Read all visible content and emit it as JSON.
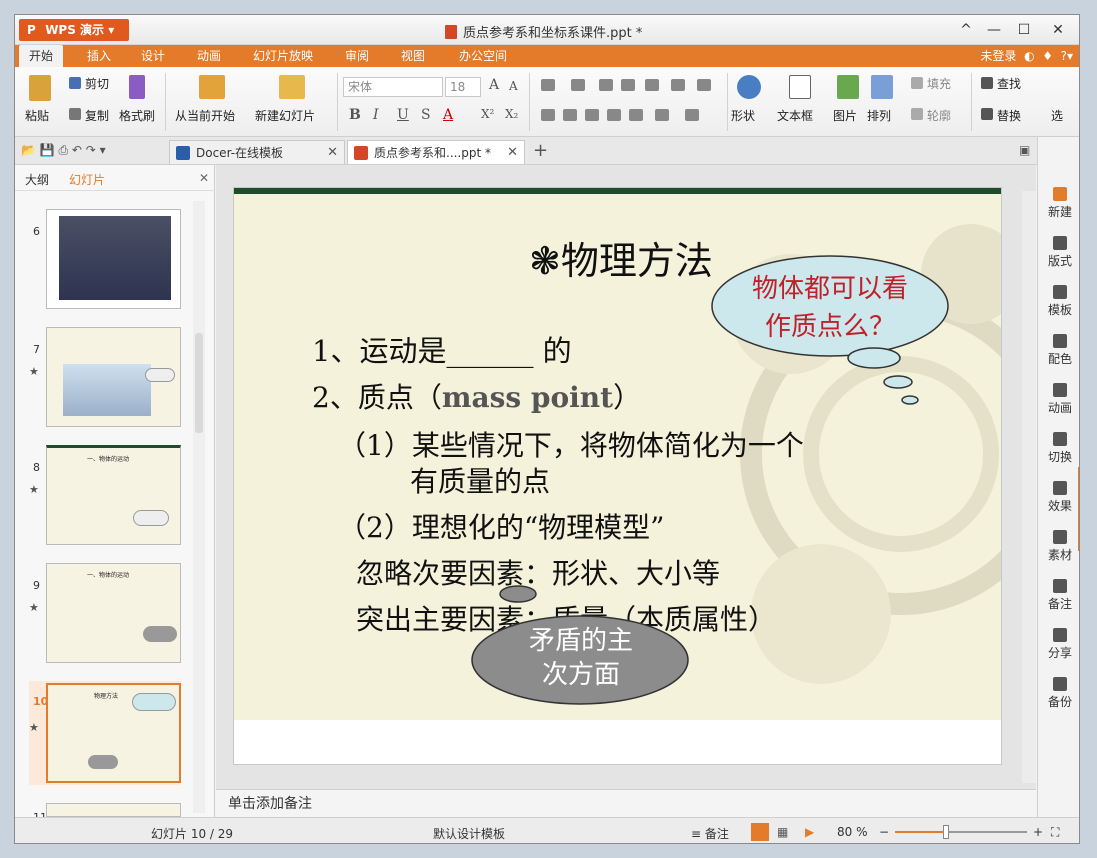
{
  "app": {
    "menu_label": "WPS 演示",
    "doc_title": "质点参考系和坐标系课件.ppt *"
  },
  "window_controls": [
    "^",
    "—",
    "☐",
    "✕"
  ],
  "tabs": [
    "开始",
    "插入",
    "设计",
    "动画",
    "幻灯片放映",
    "审阅",
    "视图",
    "办公空间"
  ],
  "tabs_right": {
    "login": "未登录",
    "help": "?"
  },
  "ribbon": {
    "paste": "粘贴",
    "cut": "剪切",
    "copy": "复制",
    "format_painter": "格式刷",
    "from_current": "从当前开始",
    "new_slide": "新建幻灯片",
    "font_name": "宋体",
    "font_size": "18",
    "bold": "B",
    "italic": "I",
    "underline": "U",
    "strike": "S",
    "font_color": "A",
    "superscript": "X²",
    "subscript": "X₂",
    "shape": "形状",
    "textbox": "文本框",
    "picture": "图片",
    "arrange": "排列",
    "fill": "填充",
    "outline": "轮廓",
    "find": "查找",
    "replace": "替换",
    "select": "选"
  },
  "doc_tabs": [
    {
      "label": "Docer-在线模板"
    },
    {
      "label": "质点参考系和....ppt *"
    }
  ],
  "left_panel": {
    "tab_outline": "大纲",
    "tab_slides": "幻灯片",
    "thumbs": [
      {
        "num": "6"
      },
      {
        "num": "7"
      },
      {
        "num": "8",
        "title": "一、物体的运动"
      },
      {
        "num": "9",
        "title": "一、物体的运动"
      },
      {
        "num": "10",
        "title": "物理方法"
      },
      {
        "num": "11"
      }
    ]
  },
  "slide": {
    "title": "❃物理方法",
    "line1": "1、运动是______ 的",
    "line2_a": "2、质点（",
    "line2_b": "mass point",
    "line2_c": "）",
    "line3": "（1）某些情况下，将物体简化为一个",
    "line4": "有质量的点",
    "line5": "（2）理想化的“物理模型”",
    "line6": "忽略次要因素：形状、大小等",
    "line7": "突出主要因素：质量（本质属性）",
    "cloud1": [
      "物体都可以看",
      "作质点么？"
    ],
    "cloud2": [
      "矛盾的主",
      "次方面"
    ]
  },
  "notes_placeholder": "单击添加备注",
  "right_sidebar": [
    "新建",
    "版式",
    "模板",
    "配色",
    "动画",
    "切换",
    "效果",
    "素材",
    "备注",
    "分享",
    "备份"
  ],
  "status": {
    "slide_info": "幻灯片 10 / 29",
    "template": "默认设计模板",
    "notes_btn": "备注",
    "zoom": "80 %"
  },
  "colors": {
    "accent": "#e37b2b",
    "cloud1_fill": "#cde8ec",
    "cloud2_fill": "#8c8c8c",
    "cloud1_text": "#c0202a"
  }
}
